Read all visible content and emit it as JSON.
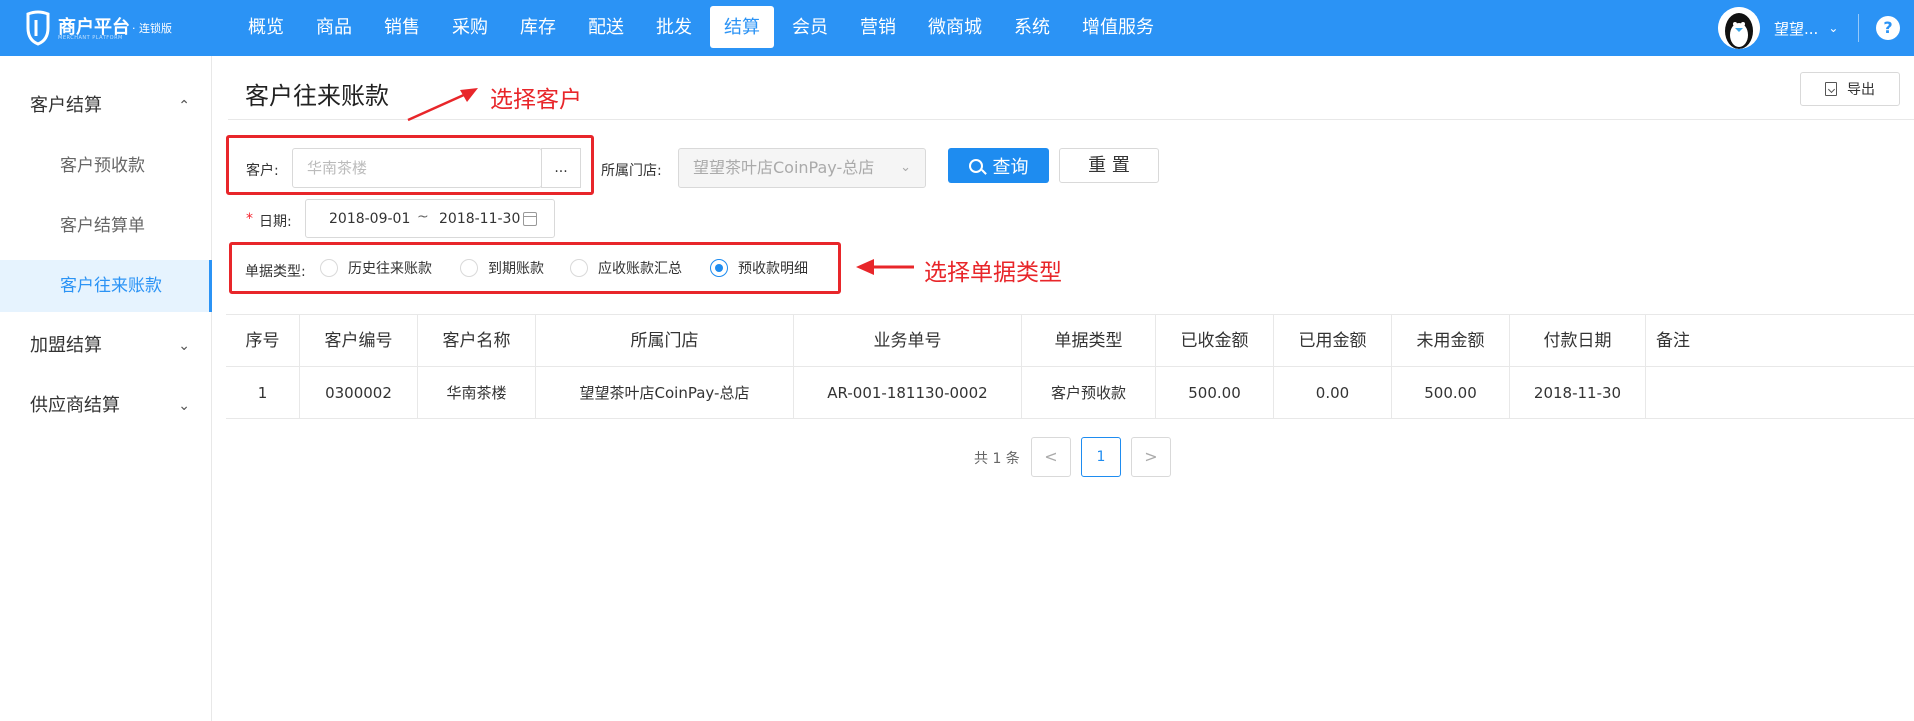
{
  "app": {
    "name": "商户平台",
    "edition": "· 连锁版",
    "subtitle": "MERCHANT PLATFORM"
  },
  "nav": [
    "概览",
    "商品",
    "销售",
    "采购",
    "库存",
    "配送",
    "批发",
    "结算",
    "会员",
    "营销",
    "微商城",
    "系统",
    "增值服务"
  ],
  "nav_active": "结算",
  "user": {
    "name": "望望...",
    "help": "?"
  },
  "sidebar": {
    "group1": "客户结算",
    "items": [
      "客户预收款",
      "客户结算单",
      "客户往来账款"
    ],
    "group2": "加盟结算",
    "group3": "供应商结算"
  },
  "page": {
    "title": "客户往来账款",
    "export": "导出"
  },
  "filters": {
    "customer_label": "客户:",
    "customer_placeholder": "华南茶楼",
    "ellipsis": "...",
    "store_label": "所属门店:",
    "store_value": "望望茶叶店CoinPay-总店",
    "query": "查询",
    "reset": "重 置",
    "date_required": "*",
    "date_label": "日期:",
    "date_start": "2018-09-01",
    "date_sep": "~",
    "date_end": "2018-11-30",
    "doc_type_label": "单据类型:",
    "doc_types": [
      "历史往来账款",
      "到期账款",
      "应收账款汇总",
      "预收款明细"
    ],
    "doc_type_selected": "预收款明细"
  },
  "annotations": {
    "select_customer": "选择客户",
    "select_doc_type": "选择单据类型"
  },
  "table": {
    "columns": [
      "序号",
      "客户编号",
      "客户名称",
      "所属门店",
      "业务单号",
      "单据类型",
      "已收金额",
      "已用金额",
      "未用金额",
      "付款日期",
      "备注"
    ],
    "rows": [
      [
        "1",
        "0300002",
        "华南茶楼",
        "望望茶叶店CoinPay-总店",
        "AR-001-181130-0002",
        "客户预收款",
        "500.00",
        "0.00",
        "500.00",
        "2018-11-30",
        ""
      ]
    ]
  },
  "pagination": {
    "total": "共 1 条",
    "prev": "<",
    "current": "1",
    "next": ">"
  },
  "colors": {
    "primary": "#2b93f5",
    "button": "#1e8cf0",
    "annotation": "#e8262a"
  }
}
